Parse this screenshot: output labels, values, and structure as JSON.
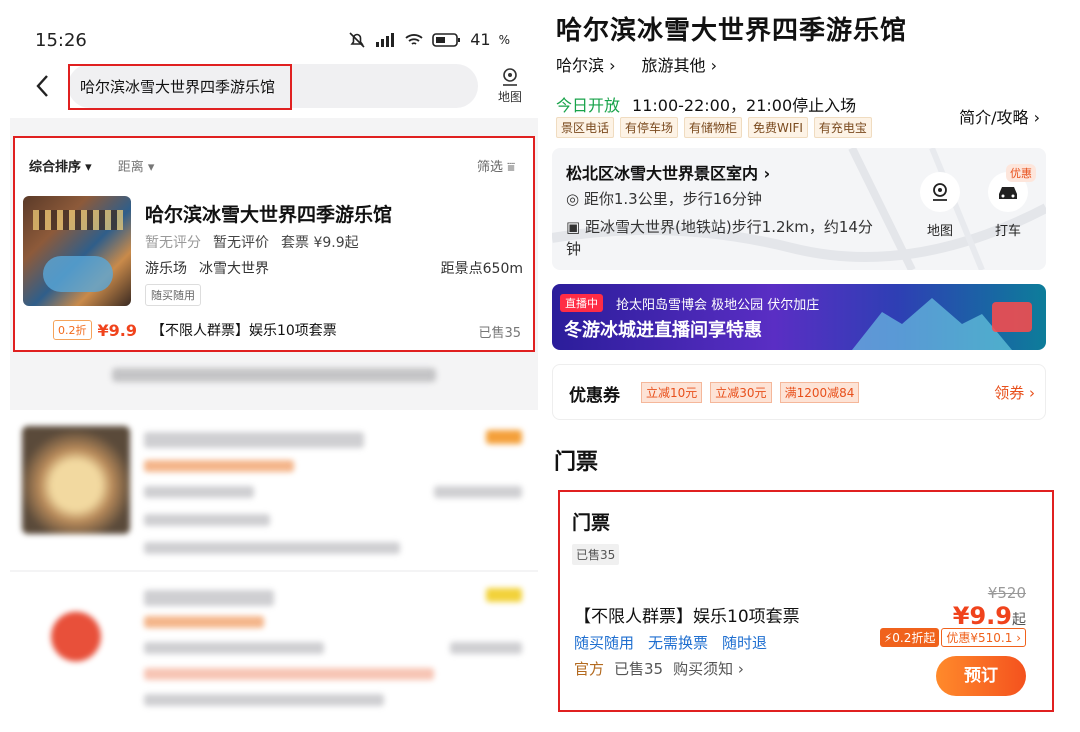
{
  "status_bar": {
    "time": "15:26",
    "battery": "41"
  },
  "search": {
    "query": "哈尔滨冰雪大世界四季游乐馆",
    "map_label": "地图"
  },
  "sort": {
    "composite": "综合排序",
    "distance": "距离",
    "filter": "筛选"
  },
  "result": {
    "title": "哈尔滨冰雪大世界四季游乐馆",
    "no_score": "暂无评分",
    "no_review": "暂无评价",
    "ticket_from": "套票 ¥9.9起",
    "tag1": "游乐场",
    "tag2": "冰雪大世界",
    "distance": "距景点650m",
    "badge": "随买随用",
    "discount": "0.2折",
    "deal_price": "¥9.9",
    "deal_name": "【不限人群票】娱乐10项套票",
    "sold": "已售35"
  },
  "detail": {
    "title": "哈尔滨冰雪大世界四季游乐馆",
    "breadcrumb": [
      "哈尔滨",
      "旅游其他"
    ],
    "open_status": "今日开放",
    "hours": "11:00-22:00，21:00停止入场",
    "amenities": [
      "景区电话",
      "有停车场",
      "有储物柜",
      "免费WIFI",
      "有充电宝"
    ],
    "guide_link": "简介/攻略",
    "location": {
      "area": "松北区冰雪大世界景区室内",
      "distance": "距你1.3公里，步行16分钟",
      "metro": "距冰雪大世界(地铁站)步行1.2km，约14分钟",
      "map_label": "地图",
      "taxi_label": "打车",
      "promo": "优惠"
    },
    "banner": {
      "live": "直播中",
      "line1": "抢太阳岛雪博会 极地公园 伏尔加庄",
      "line2": "冬游冰城进直播间享特惠"
    },
    "coupons": {
      "label": "优惠券",
      "items": [
        "立减10元",
        "立减30元",
        "满1200减84"
      ],
      "get": "领券"
    },
    "section_title": "门票",
    "ticket": {
      "header": "门票",
      "sold": "已售35",
      "name": "【不限人群票】娱乐10项套票",
      "features": [
        "随买随用",
        "无需换票",
        "随时退"
      ],
      "official": "官方",
      "sold2": "已售35",
      "notice": "购买须知",
      "original_price": "¥520",
      "price": "¥9.9",
      "price_suffix": "起",
      "discount": "0.2折起",
      "saving": "优惠¥510.1",
      "book": "预订"
    }
  }
}
